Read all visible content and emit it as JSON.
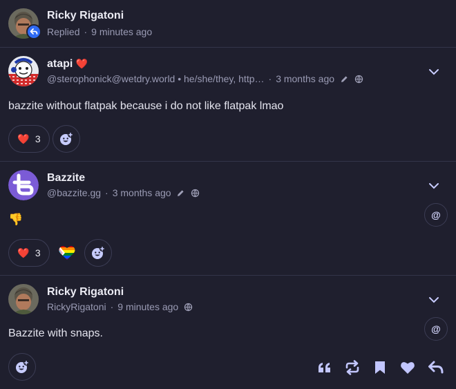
{
  "colors": {
    "accent": "#b9c0ff",
    "heart": "#e8283a",
    "background": "#1f1f2e",
    "divider": "#33344a"
  },
  "header": {
    "name": "Ricky Rigatoni",
    "status": "Replied",
    "time": "9 minutes ago"
  },
  "posts": [
    {
      "name": "atapi",
      "name_emoji": "❤️",
      "handle": "@sterophonick@wetdry.world • he/she/they, http…",
      "time": "3 months ago",
      "text": "bazzite without flatpak because i do not like flatpak lmao",
      "reaction_count": "3",
      "reaction_emoji": "❤️"
    },
    {
      "name": "Bazzite",
      "handle": "@bazzite.gg",
      "time": "3 months ago",
      "text": "👎",
      "reaction_count": "3",
      "reaction_emoji": "❤️",
      "mention_label": "@"
    },
    {
      "name": "Ricky Rigatoni",
      "handle": "RickyRigatoni",
      "time": "9 minutes ago",
      "text": "Bazzite with snaps.",
      "mention_label": "@"
    }
  ],
  "icons": {
    "reply_badge": "reply-arrow-icon",
    "edited": "pencil-icon",
    "visibility": "globe-icon",
    "expand": "chevron-down-icon",
    "add_reaction": "smiley-plus-icon",
    "quote": "quote-icon",
    "boost": "repeat-icon",
    "bookmark": "bookmark-icon",
    "favourite": "heart-icon",
    "reply": "reply-icon"
  }
}
